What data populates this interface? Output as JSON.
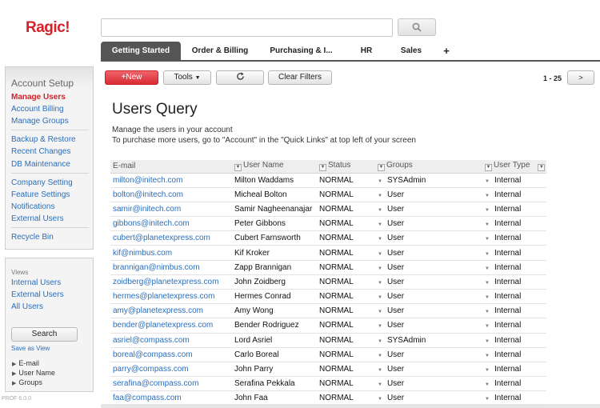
{
  "app": {
    "logo": "Ragic!",
    "version": "PROF 6.0.0"
  },
  "header": {
    "search_placeholder": "",
    "tabs": [
      {
        "label": "Getting Started",
        "active": true
      },
      {
        "label": "Order & Billing",
        "active": false
      },
      {
        "label": "Purchasing & I...",
        "active": false
      },
      {
        "label": "HR",
        "active": false
      },
      {
        "label": "Sales",
        "active": false
      }
    ],
    "add_tab_label": "+"
  },
  "sidebar": {
    "account_setup": {
      "title": "Account Setup",
      "groups": [
        [
          {
            "label": "Manage Users",
            "active": true
          },
          {
            "label": "Account Billing"
          },
          {
            "label": "Manage Groups"
          }
        ],
        [
          {
            "label": "Backup & Restore"
          },
          {
            "label": "Recent Changes"
          },
          {
            "label": "DB Maintenance"
          }
        ],
        [
          {
            "label": "Company Setting"
          },
          {
            "label": "Feature Settings"
          },
          {
            "label": "Notifications"
          },
          {
            "label": "External Users"
          }
        ],
        [
          {
            "label": "Recycle Bin"
          }
        ]
      ]
    },
    "views": {
      "label": "Views",
      "items": [
        "Internal Users",
        "External Users",
        "All Users"
      ],
      "search_label": "Search",
      "save_as_view": "Save as View",
      "fields": [
        "E-mail",
        "User Name",
        "Groups"
      ]
    }
  },
  "toolbar": {
    "new_label": "+New",
    "tools_label": "Tools",
    "clear_filters_label": "Clear Filters",
    "pager_text": "1 - 25",
    "next_label": ">"
  },
  "main": {
    "title": "Users Query",
    "desc_line1": "Manage the users in your account",
    "desc_line2": "To purchase more users, go to \"Account\" in the \"Quick Links\" at top left of your screen"
  },
  "table": {
    "columns": [
      "E-mail",
      "User Name",
      "Status",
      "Groups",
      "User Type"
    ],
    "rows": [
      [
        "milton@initech.com",
        "Milton Waddams",
        "NORMAL",
        "SYSAdmin",
        "Internal"
      ],
      [
        "bolton@initech.com",
        "Micheal Bolton",
        "NORMAL",
        "User",
        "Internal"
      ],
      [
        "samir@initech.com",
        "Samir Nagheenanajar",
        "NORMAL",
        "User",
        "Internal"
      ],
      [
        "gibbons@initech.com",
        "Peter Gibbons",
        "NORMAL",
        "User",
        "Internal"
      ],
      [
        "cubert@planetexpress.com",
        "Cubert Farnsworth",
        "NORMAL",
        "User",
        "Internal"
      ],
      [
        "kif@nimbus.com",
        "Kif Kroker",
        "NORMAL",
        "User",
        "Internal"
      ],
      [
        "brannigan@nimbus.com",
        "Zapp Brannigan",
        "NORMAL",
        "User",
        "Internal"
      ],
      [
        "zoidberg@planetexpress.com",
        "John Zoidberg",
        "NORMAL",
        "User",
        "Internal"
      ],
      [
        "hermes@planetexpress.com",
        "Hermes Conrad",
        "NORMAL",
        "User",
        "Internal"
      ],
      [
        "amy@planetexpress.com",
        "Amy Wong",
        "NORMAL",
        "User",
        "Internal"
      ],
      [
        "bender@planetexpress.com",
        "Bender Rodriguez",
        "NORMAL",
        "User",
        "Internal"
      ],
      [
        "asriel@compass.com",
        "Lord Asriel",
        "NORMAL",
        "SYSAdmin",
        "Internal"
      ],
      [
        "boreal@compass.com",
        "Carlo Boreal",
        "NORMAL",
        "User",
        "Internal"
      ],
      [
        "parry@compass.com",
        "John Parry",
        "NORMAL",
        "User",
        "Internal"
      ],
      [
        "serafina@compass.com",
        "Serafina Pekkala",
        "NORMAL",
        "User",
        "Internal"
      ],
      [
        "faa@compass.com",
        "John Faa",
        "NORMAL",
        "User",
        "Internal"
      ]
    ]
  },
  "icons": {
    "search": "search-icon",
    "refresh": "refresh-icon",
    "caret": "caret-down-icon",
    "filter": "filter-icon"
  },
  "colors": {
    "brand_red": "#d4212a",
    "link_blue": "#2a6ebb",
    "active_tab": "#555555"
  }
}
